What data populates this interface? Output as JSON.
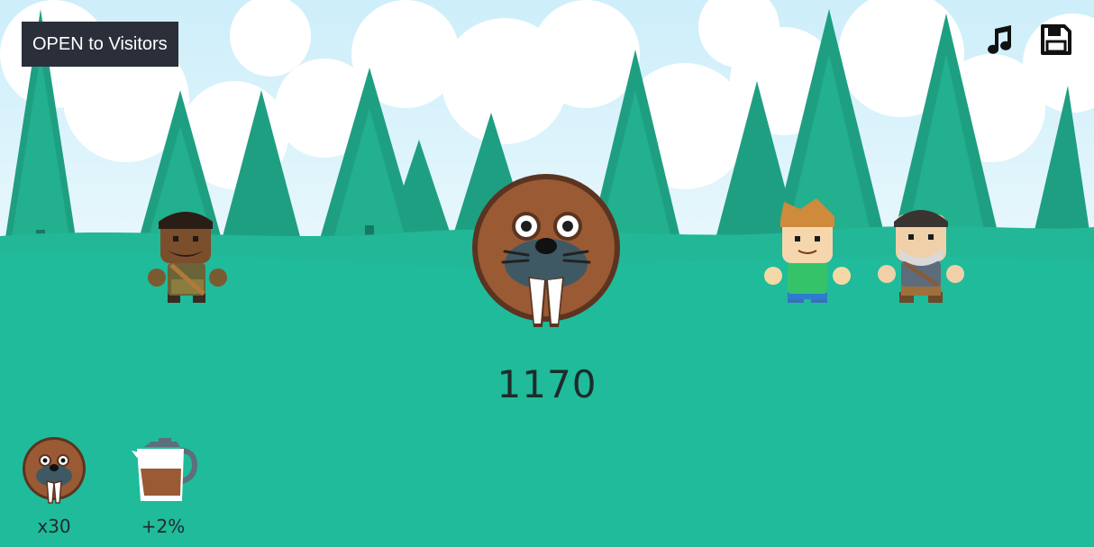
{
  "status_button": {
    "label": "OPEN to Visitors"
  },
  "score": {
    "value": "1170"
  },
  "toolbar": {
    "music_icon": "music-note-icon",
    "save_icon": "floppy-disk-icon"
  },
  "items": [
    {
      "name": "walrus",
      "icon": "walrus-icon",
      "label": "x30"
    },
    {
      "name": "coffee-pot",
      "icon": "coffee-pot-icon",
      "label": "+2%"
    }
  ],
  "visitors": [
    "visitor-bearded",
    "visitor-blonde",
    "visitor-grey-beard"
  ],
  "colors": {
    "grass": "#1fbb9b",
    "sky": "#dff3fb",
    "tree_dark": "#1e9e80",
    "tree_light": "#25b892",
    "walrus_brown": "#9a5a34"
  }
}
